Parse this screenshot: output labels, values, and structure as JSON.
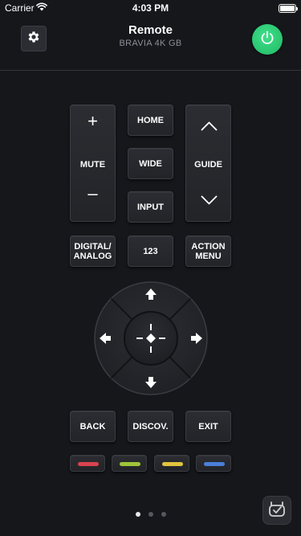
{
  "status_bar": {
    "carrier": "Carrier",
    "time": "4:03 PM"
  },
  "header": {
    "title": "Remote",
    "subtitle": "BRAVIA 4K GB"
  },
  "buttons": {
    "volume_up": "+",
    "mute": "MUTE",
    "volume_down": "–",
    "home": "HOME",
    "wide": "WIDE",
    "input": "INPUT",
    "guide": "GUIDE",
    "digital_analog": "DIGITAL/ ANALOG",
    "num_123": "123",
    "action_menu": "ACTION MENU",
    "back": "BACK",
    "discov": "DISCOV.",
    "exit": "EXIT"
  },
  "color_keys": [
    "#d9434e",
    "#9fc43a",
    "#e2c43f",
    "#4a7fd8"
  ],
  "colors": {
    "power": "#2fd078",
    "background": "#15171b"
  },
  "pagination": {
    "pages": 3,
    "active": 0
  }
}
